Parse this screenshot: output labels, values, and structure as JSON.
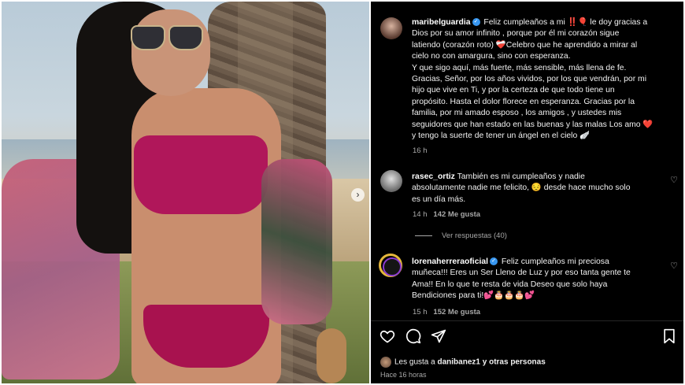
{
  "post": {
    "author": "maribelguardia",
    "caption_lines": [
      "Feliz cumpleaños a mi ‼️🎈 le doy gracias a",
      "Dios por su amor infinito , porque por él mi corazón sigue",
      "latiendo (corazón roto) ❤️‍🩹Celebro que he aprendido a mirar al",
      "cielo no con amargura, sino con esperanza.",
      "Y que sigo aquí, más fuerte, más sensible, más llena de fe.",
      "Gracias, Señor, por los años vividos, por los que vendrán, por mi",
      "hijo que vive en Ti, y por la certeza de que todo tiene un",
      "propósito. Hasta el dolor florece en esperanza. Gracias por la",
      "familia, por mi amado esposo , los amigos , y ustedes mis",
      "seguidores que han estado en las buenas y las malas Los amo ❤️",
      "y tengo la suerte de tener un ángel en el cielo 🪽"
    ],
    "age": "16 h"
  },
  "comments": [
    {
      "user": "rasec_ortiz",
      "lines": [
        "También es mi cumpleaños y nadie",
        "absolutamente nadie me felicito, 😔 desde hace mucho solo",
        "es un día más."
      ],
      "age": "14 h",
      "likes": "142 Me gusta",
      "replies": "Ver respuestas (40)"
    },
    {
      "user": "lorenaherreraoficial",
      "lines": [
        "Feliz cumpleaños mi preciosa",
        "muñeca!!! Eres un Ser Lleno de Luz y por eso tanta gente te",
        "Ama!! En lo que te resta de vida Deseo que solo haya",
        "Bendiciones para ti!💕🎂🎂🎂💕"
      ],
      "age": "15 h",
      "likes": "152 Me gusta"
    }
  ],
  "footer": {
    "likes_prefix": "Les gusta a",
    "likes_user": "danibanez1",
    "likes_suffix": "y otras personas",
    "timestamp": "Hace 16 horas"
  },
  "icons": {
    "like": "heart-icon",
    "comment": "comment-icon",
    "share": "share-icon",
    "save": "bookmark-icon",
    "carousel": "chevron-right-icon",
    "verified": "verified-badge-icon"
  },
  "colors": {
    "verified": "#3897f0",
    "panel_bg": "#000000",
    "muted_text": "#a8a8a8"
  }
}
